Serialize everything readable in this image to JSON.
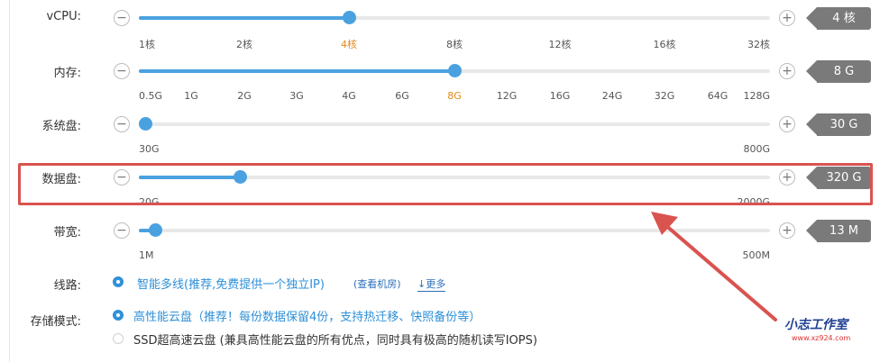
{
  "rows": [
    {
      "label": "vCPU:",
      "value": "4 核",
      "fill": 0.333,
      "ticks": [
        "1核",
        "2核",
        "4核",
        "8核",
        "12核",
        "16核",
        "32核"
      ],
      "active_tick": 2
    },
    {
      "label": "内存:",
      "value": "8 G",
      "fill": 0.5,
      "ticks": [
        "0.5G",
        "1G",
        "2G",
        "3G",
        "4G",
        "6G",
        "8G",
        "12G",
        "16G",
        "24G",
        "32G",
        "64G",
        "128G"
      ],
      "active_tick": 6
    },
    {
      "label": "系统盘:",
      "value": "30 G",
      "fill": 0,
      "ticks": [
        "30G",
        "800G"
      ],
      "active_tick": -1
    },
    {
      "label": "数据盘:",
      "value": "320 G",
      "fill": 0.16,
      "ticks": [
        "20G",
        "2000G"
      ],
      "active_tick": -1
    },
    {
      "label": "带宽:",
      "value": "13 M",
      "fill": 0.025,
      "ticks": [
        "1M",
        "500M"
      ],
      "active_tick": -1
    }
  ],
  "route": {
    "label": "线路:",
    "option": "智能多线(推荐,免费提供一个独立IP)",
    "view_rooms": "(查看机房)",
    "more": "↓更多"
  },
  "storage": {
    "label": "存储模式:",
    "options": [
      {
        "text": "高性能云盘（推荐！每份数据保留4份，支持热迁移、快照备份等）",
        "selected": true
      },
      {
        "text": "SSD超高速云盘 (兼具高性能云盘的所有优点，同时具有极高的随机读写IOPS)",
        "selected": false
      }
    ]
  },
  "buttons": {
    "minus": "−",
    "plus": "+"
  },
  "watermark": {
    "title": "小志工作室",
    "url": "www.xz924.com"
  },
  "colors": {
    "accent": "#4aa1e0",
    "active_tick": "#e08a1b",
    "highlight": "#d9534f",
    "badge": "#7a7a7a"
  }
}
